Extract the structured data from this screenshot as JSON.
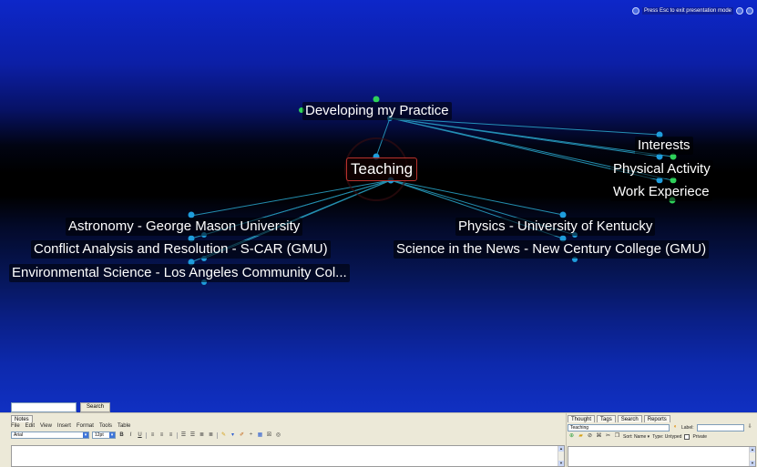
{
  "presentation": {
    "notice": "Press Esc to exit presentation mode"
  },
  "plex": {
    "parent": "Developing my Practice",
    "active": "Teaching",
    "jumps": [
      "Interests",
      "Physical Activity",
      "Work Experiece"
    ],
    "children_left": [
      "Astronomy - George Mason University",
      "Conflict Analysis and Resolution - S-CAR (GMU)",
      "Environmental Science - Los Angeles Community Col..."
    ],
    "children_right": [
      "Physics - University of Kentucky",
      "Science in the News - New Century College (GMU)"
    ],
    "colors": {
      "link": "#2aa7cc",
      "gate_blue": "#1e9ddc",
      "gate_green": "#2ed15a",
      "active_border": "#b8322d"
    }
  },
  "search": {
    "value": "",
    "button": "Search"
  },
  "notes": {
    "tab": "Notes",
    "menu": [
      "File",
      "Edit",
      "View",
      "Insert",
      "Format",
      "Tools",
      "Table"
    ],
    "font": "Arial",
    "size": "12pt",
    "format_icons": [
      "bold-icon",
      "italic-icon",
      "underline-icon",
      "align-left-icon",
      "align-center-icon",
      "align-right-icon",
      "bullet-list-icon",
      "numbered-list-icon",
      "outdent-icon",
      "indent-icon",
      "highlight-icon",
      "text-color-icon",
      "eraser-icon",
      "rule-icon",
      "table-icon",
      "image-icon",
      "link-icon"
    ],
    "format_glyphs": {
      "bold": "B",
      "italic": "I",
      "underline": "U"
    }
  },
  "properties": {
    "tabs": [
      "Thought",
      "Tags",
      "Search",
      "Reports"
    ],
    "thought_name": "Teaching",
    "label_caption": "Label:",
    "sort": "Sort: Name ▾",
    "type": "Type: Untyped",
    "private": "Private"
  }
}
